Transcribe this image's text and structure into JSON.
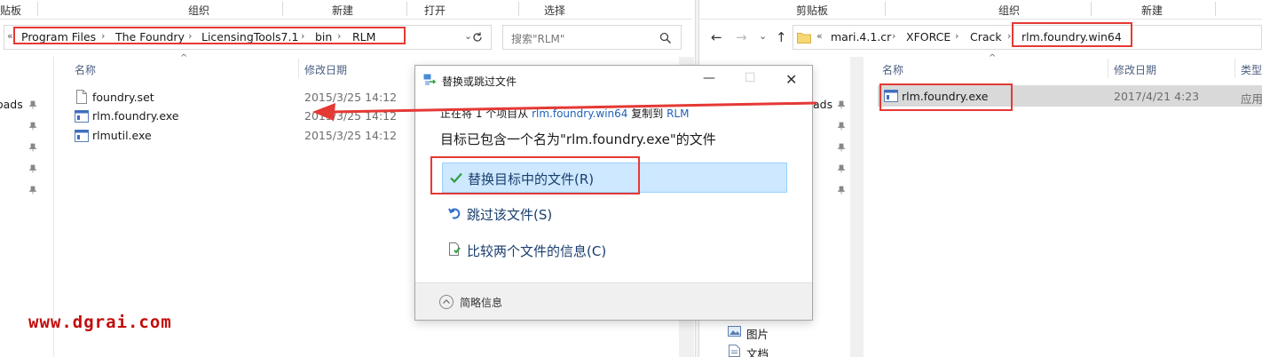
{
  "left_window": {
    "ribbon": {
      "clipboard_partial": "贴板",
      "organize": "组织",
      "new": "新建",
      "open": "打开",
      "select": "选择"
    },
    "breadcrumb": [
      "Program Files",
      "The Foundry",
      "LicensingTools7.1",
      "bin",
      "RLM"
    ],
    "breadcrumb_prefix": "«",
    "search_placeholder": "搜索\"RLM\"",
    "columns": {
      "name": "名称",
      "date": "修改日期"
    },
    "files": [
      {
        "name": "foundry.set",
        "date": "2015/3/25 14:12",
        "icon": "document-icon"
      },
      {
        "name": "rlm.foundry.exe",
        "date": "2015/3/25 14:12",
        "icon": "exe-icon"
      },
      {
        "name": "rlmutil.exe",
        "date": "2015/3/25 14:12",
        "icon": "exe-icon"
      }
    ],
    "nav_partial": "oads"
  },
  "right_window": {
    "ribbon": {
      "clipboard": "剪贴板",
      "organize": "组织",
      "new": "新建"
    },
    "breadcrumb": [
      "mari.4.1.cr",
      "XFORCE",
      "Crack",
      "rlm.foundry.win64"
    ],
    "breadcrumb_prefix": "«",
    "columns": {
      "name": "名称",
      "date": "修改日期",
      "type_partial": "类型"
    },
    "files": [
      {
        "name": "rlm.foundry.exe",
        "date": "2017/4/21 4:23",
        "type_partial": "应用",
        "icon": "exe-icon"
      }
    ],
    "nav_partial": "ads",
    "nav_items": [
      {
        "label": "图片",
        "icon": "pictures-icon"
      },
      {
        "label": "文档",
        "icon": "documents-icon"
      }
    ]
  },
  "dialog": {
    "title": "替换或跳过文件",
    "copy_line_prefix": "正在将 1 个项目从 ",
    "copy_source": "rlm.foundry.win64",
    "copy_line_mid": " 复制到 ",
    "copy_target": "RLM",
    "message": "目标已包含一个名为\"rlm.foundry.exe\"的文件",
    "options": [
      {
        "label": "替换目标中的文件(R)",
        "icon": "checkmark-icon"
      },
      {
        "label": "跳过该文件(S)",
        "icon": "skip-icon"
      },
      {
        "label": "比较两个文件的信息(C)",
        "icon": "compare-icon"
      }
    ],
    "details_label": "简略信息"
  },
  "watermark": "www.dgrai.com",
  "colors": {
    "highlight_red": "#e53935",
    "selection_blue": "#cde8ff",
    "link_blue": "#1f62b8",
    "watermark_red": "#c20c0c"
  }
}
